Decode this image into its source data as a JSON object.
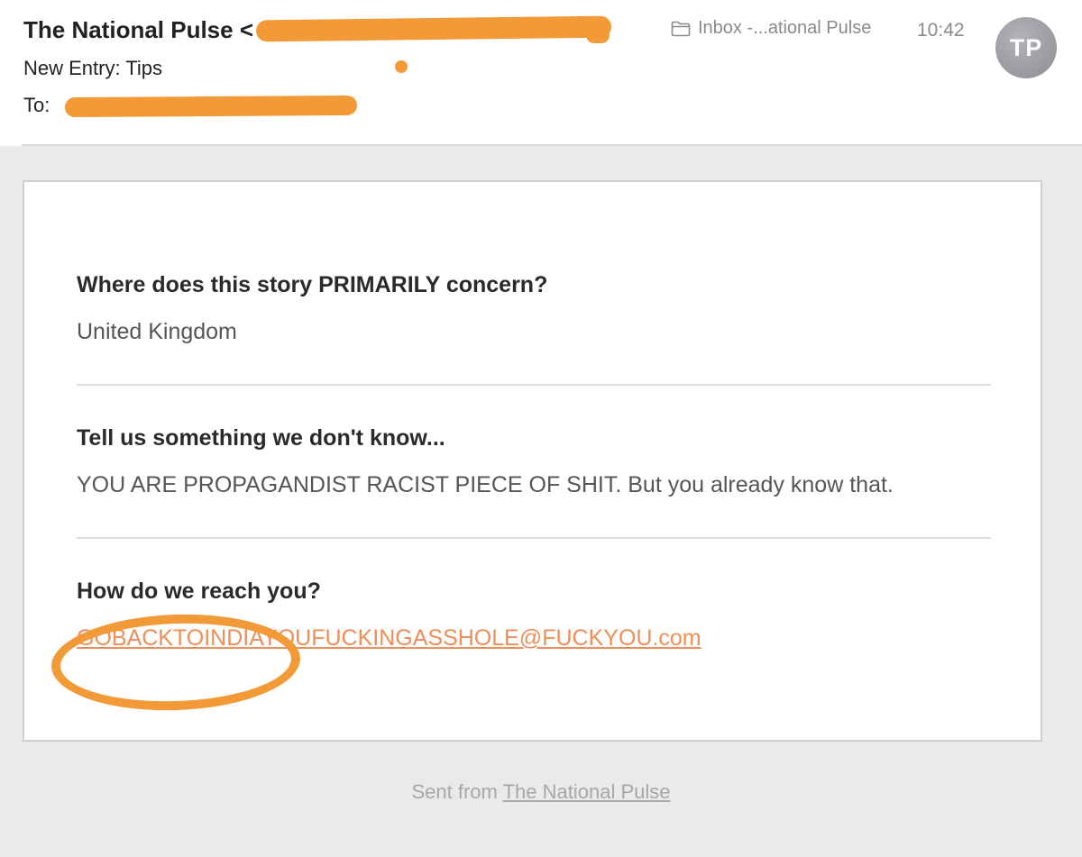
{
  "header": {
    "sender_name": "The National Pulse <",
    "subject": "New Entry: Tips",
    "to_label": "To:",
    "mailbox": "Inbox -...ational Pulse",
    "time": "10:42",
    "avatar_initials": "TP",
    "folder_icon": "folder-icon",
    "redaction_color": "#f29a38"
  },
  "form": {
    "entries": [
      {
        "question": "Where does this story PRIMARILY concern?",
        "answer": "United Kingdom"
      },
      {
        "question": "Tell us something we don't know...",
        "answer": "YOU ARE PROPAGANDIST RACIST PIECE OF SHIT. But you already know that."
      },
      {
        "question": "How do we reach you?",
        "answer": "GOBACKTOINDIAYOUFUCKINGASSHOLE@FUCKYOU.com"
      }
    ],
    "link_color": "#ef8e56",
    "annotation_color": "#f29a38"
  },
  "footer": {
    "prefix": "Sent from ",
    "link": "The National Pulse"
  }
}
